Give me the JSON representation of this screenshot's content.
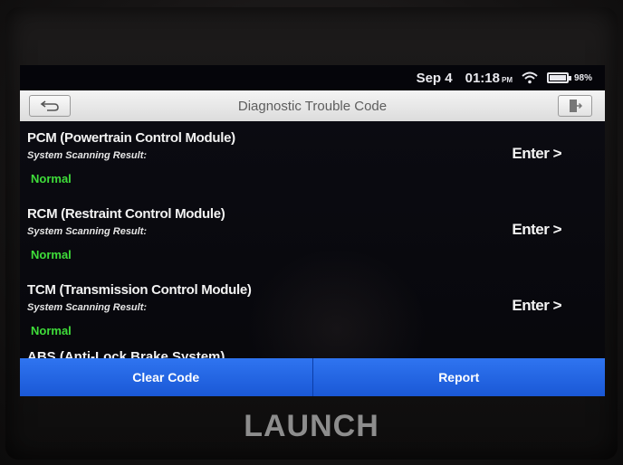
{
  "status_bar": {
    "date": "Sep 4",
    "time": "01:18",
    "ampm": "PM",
    "battery": "98%",
    "wifi_icon": "wifi-icon",
    "battery_icon": "battery-icon"
  },
  "title_bar": {
    "title": "Diagnostic Trouble Code",
    "back_icon": "back-arrow-icon",
    "exit_icon": "exit-icon"
  },
  "modules": [
    {
      "name": "PCM (Powertrain Control Module)",
      "sub": "System Scanning Result:",
      "status": "Normal",
      "action": "Enter >"
    },
    {
      "name": "RCM (Restraint Control Module)",
      "sub": "System Scanning Result:",
      "status": "Normal",
      "action": "Enter >"
    },
    {
      "name": "TCM (Transmission Control Module)",
      "sub": "System Scanning Result:",
      "status": "Normal",
      "action": "Enter >"
    }
  ],
  "partial_module": "ABS (Anti-Lock Brake System)",
  "bottom_buttons": {
    "clear": "Clear Code",
    "report": "Report"
  },
  "brand": "LAUNCH",
  "colors": {
    "status_normal": "#3fdd3a",
    "button_blue": "#1a58d6"
  }
}
